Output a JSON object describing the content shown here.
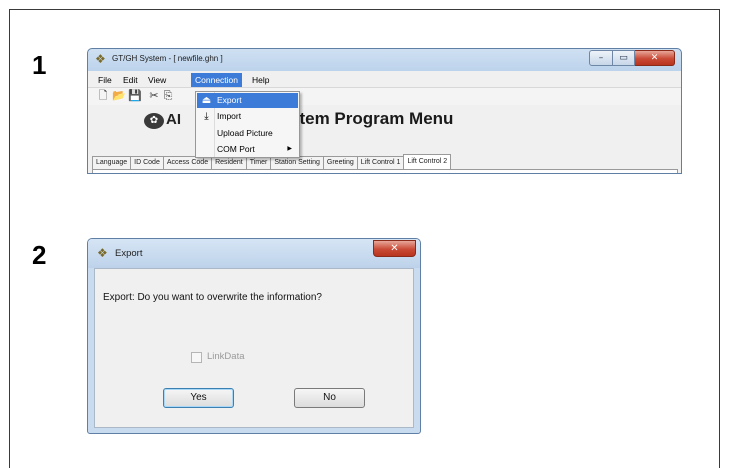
{
  "steps": [
    "1",
    "2"
  ],
  "window1": {
    "title": "GT/GH System - [ newfile.ghn ]",
    "caption_buttons": {
      "minimize": "–",
      "maximize": "▭",
      "close": "✕"
    },
    "menu": [
      {
        "label": "File"
      },
      {
        "label": "Edit"
      },
      {
        "label": "View"
      },
      {
        "label": "Connection",
        "active": true
      },
      {
        "label": "Help"
      }
    ],
    "toolbar_icons": [
      "new-file-icon",
      "open-folder-icon",
      "save-icon",
      "cut-icon",
      "copy-icon"
    ],
    "logo_text": "AI",
    "program_title": "stem Program Menu",
    "tabs": [
      "Language",
      "ID Code",
      "Access Code",
      "Resident",
      "Timer",
      "Station Setting",
      "Greeting",
      "Lift Control 1",
      "Lift Control 2"
    ],
    "selected_tab": "Lift Control 2",
    "dropdown": {
      "items": [
        {
          "label": "Export",
          "icon": "export-icon",
          "highlighted": true
        },
        {
          "label": "Import",
          "icon": "import-icon"
        },
        {
          "label": "Upload Picture",
          "icon": ""
        },
        {
          "label": "COM Port",
          "icon": "",
          "submenu": true
        }
      ]
    }
  },
  "window2": {
    "title": "Export",
    "close_glyph": "✕",
    "message": "Export: Do you want to overwrite the information?",
    "checkbox_label": "LinkData",
    "yes_label": "Yes",
    "no_label": "No"
  }
}
